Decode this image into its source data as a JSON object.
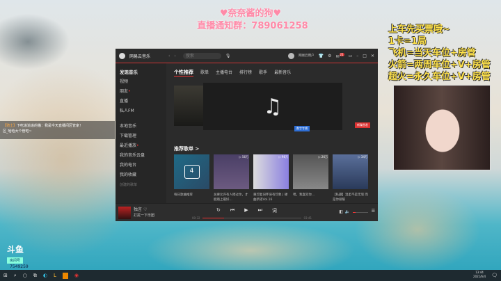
{
  "overlay": {
    "notice_title": "♥奈奈酱的狗♥",
    "notice_group": "直播通知群：789061258",
    "rules": [
      "上车先买票哦~",
      "1卡=1局",
      "飞机=当天车位+房管",
      "火箭=两周车位+V+房管",
      "超火=永久车位+V+房管"
    ],
    "platform_logo": "斗鱼",
    "room_label": "房间号",
    "room_id": "7549259",
    "chat": {
      "user": "【骑士】",
      "text": "下吃追追追的猫：我是今天直播间区管家！",
      "line2": "区_哈哈大个管吧~"
    }
  },
  "app": {
    "name": "网易云音乐",
    "search_placeholder": "搜索",
    "user": "网易云用户",
    "notif_count": "21",
    "sidebar": {
      "header": "发现音乐",
      "items": [
        "视频",
        "朋友",
        "直播",
        "私人FM"
      ],
      "local": "本地音乐",
      "download": "下载管理",
      "recent": "最近播放",
      "cloud": "我的音乐云盘",
      "radio": "我的电台",
      "collect": "我的收藏",
      "created": "创建的歌单"
    },
    "tabs": [
      "个性推荐",
      "歌单",
      "主播电台",
      "排行榜",
      "歌手",
      "最新音乐"
    ],
    "banner": {
      "tag_blue": "数字专辑",
      "tag_red": "新碟首发"
    },
    "section_title": "推荐歌单 >",
    "playlists": [
      {
        "title": "每日歌曲推荐",
        "plays": "",
        "day": "4"
      },
      {
        "title": "总要允许有人擦过你，才能踏上最好...",
        "plays": "▷ 56万"
      },
      {
        "title": "重印复旧怀旧有印象 | 硬曲新谣Vol.16",
        "plays": "▷ 98万"
      },
      {
        "title": "嘿，我喜欢你...",
        "plays": "▷ 26万"
      },
      {
        "title": "【私藏】温柔不是无瑕 而是你很暖",
        "plays": "▷ 34万"
      }
    ],
    "player": {
      "song": "独言",
      "artist": "打扰一下乐团",
      "elapsed": "00:32",
      "total": "03:41",
      "progress": 0.22
    }
  },
  "taskbar": {
    "time": "13:44",
    "date": "2021/6/4"
  }
}
